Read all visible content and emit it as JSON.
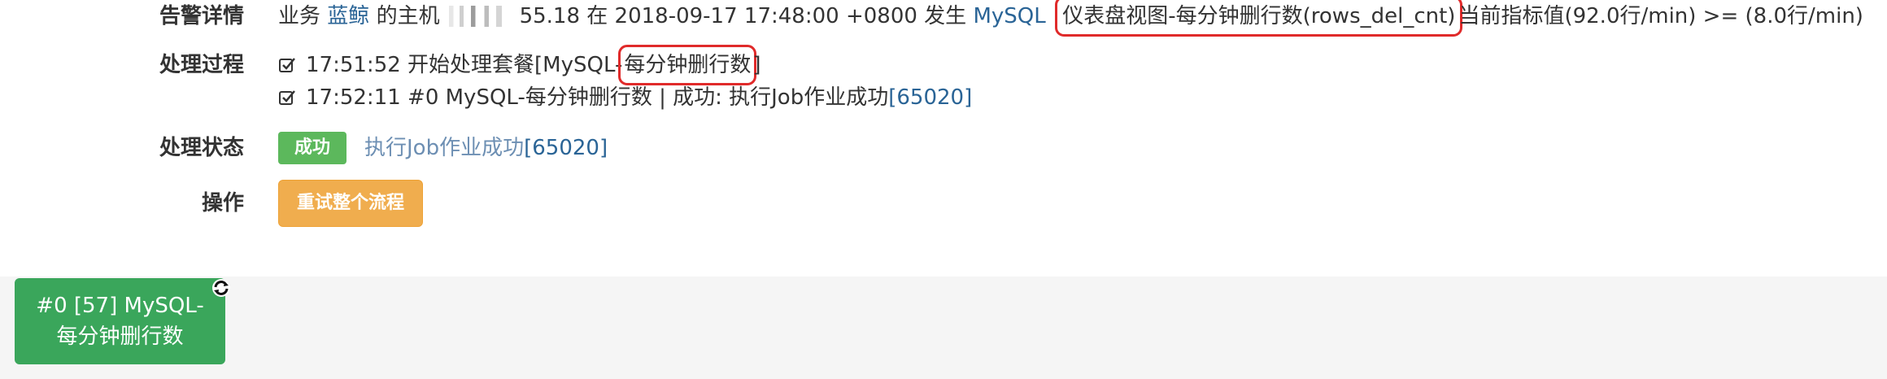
{
  "alarm": {
    "label": "告警详情",
    "prefix": "业务",
    "biz_link": "蓝鲸",
    "host_text": "的主机",
    "ip_tail": "55.18",
    "at_text": "在 2018-09-17 17:48:00 +0800 发生",
    "db_link": "MySQL",
    "metric": "仪表盘视图-每分钟删行数(rows_del_cnt)",
    "suffix": "当前指标值(92.0行/min) >= (8.0行/min)"
  },
  "process": {
    "label": "处理过程",
    "step1": {
      "time_text": "17:51:52 开始处理套餐[MySQL-",
      "highlight": "每分钟删行数",
      "close": "]"
    },
    "step2": {
      "text": "17:52:11 #0 MySQL-每分钟删行数 | 成功: 执行Job作业成功",
      "job_id": "[65020]"
    }
  },
  "status": {
    "label": "处理状态",
    "badge": "成功",
    "link_text": "执行Job作业成功",
    "link_id": "[65020]"
  },
  "action": {
    "label": "操作",
    "retry_button": "重试整个流程"
  },
  "flow_node": {
    "line1": "#0 [57] MySQL-",
    "line2": "每分钟删行数"
  },
  "colors": {
    "link": "#2a6496",
    "success": "#5cb85c",
    "warning": "#f0ad4e",
    "node": "#3aa65b",
    "highlight": "#e02a2a"
  }
}
